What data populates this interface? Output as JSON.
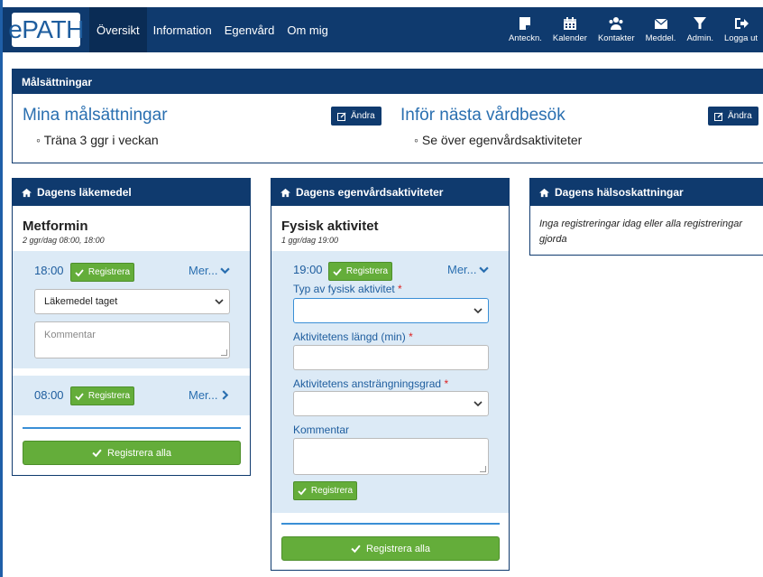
{
  "navbar": {
    "logo": "ePATH",
    "links": [
      "Översikt",
      "Information",
      "Egenvård",
      "Om mig"
    ],
    "icons": [
      {
        "label": "Anteckn.",
        "icon": "note-icon"
      },
      {
        "label": "Kalender",
        "icon": "calendar-icon"
      },
      {
        "label": "Kontakter",
        "icon": "contacts-icon"
      },
      {
        "label": "Meddel.",
        "icon": "envelope-icon"
      },
      {
        "label": "Admin.",
        "icon": "funnel-icon"
      },
      {
        "label": "Logga ut",
        "icon": "logout-icon"
      }
    ]
  },
  "goals": {
    "header": "Målsättningar",
    "mine_title": "Mina målsättningar",
    "mine_item": "Träna 3 ggr i veckan",
    "next_title": "Inför nästa vårdbesök",
    "next_item": "Se över egenvårdsaktiviteter",
    "edit_label": "Ändra"
  },
  "medicine": {
    "header": "Dagens läkemedel",
    "name": "Metformin",
    "schedule": "2 ggr/dag 08:00, 18:00",
    "slot1_time": "18:00",
    "slot2_time": "08:00",
    "register_label": "Registrera",
    "more_label": "Mer...",
    "status_select": "Läkemedel taget",
    "comment_placeholder": "Kommentar",
    "register_all": "Registrera alla"
  },
  "selfcare": {
    "header": "Dagens egenvårdsaktiviteter",
    "name": "Fysisk aktivitet",
    "schedule": "1 ggr/dag 19:00",
    "time": "19:00",
    "register_label": "Registrera",
    "more_label": "Mer...",
    "type_label": "Typ av fysisk aktivitet",
    "length_label": "Aktivitetens längd (min)",
    "intensity_label": "Aktivitetens ansträngningsgrad",
    "comment_label": "Kommentar",
    "required_mark": "*",
    "register_all": "Registrera alla"
  },
  "health": {
    "header": "Dagens hälsoskattningar",
    "empty_text": "Inga registreringar idag eller alla registreringar gjorda"
  },
  "colors": {
    "navy": "#0f3a6e",
    "accent_blue": "#2a6fb0",
    "green": "#64ad3a",
    "slot_bg": "#dceaf6"
  }
}
